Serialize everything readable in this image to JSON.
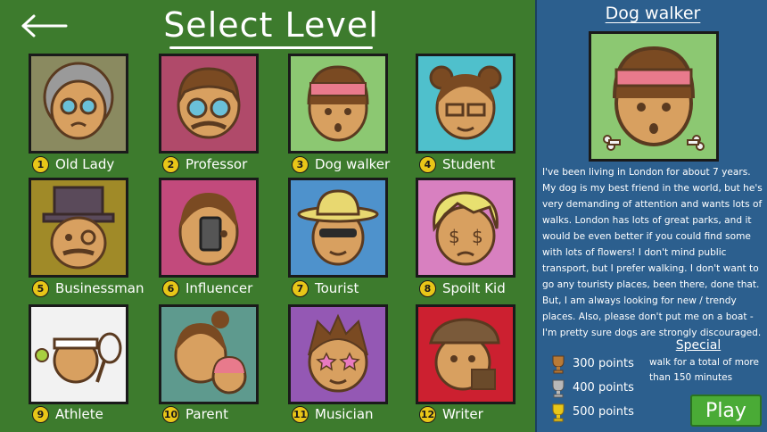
{
  "screen": {
    "title": "Select Level",
    "back_icon": "arrow-left-icon"
  },
  "levels": [
    {
      "number": "1",
      "name": "Old Lady",
      "bg": "#8a8a60"
    },
    {
      "number": "2",
      "name": "Professor",
      "bg": "#b04a6a"
    },
    {
      "number": "3",
      "name": "Dog walker",
      "bg": "#8cc872"
    },
    {
      "number": "4",
      "name": "Student",
      "bg": "#4fc0cc"
    },
    {
      "number": "5",
      "name": "Businessman",
      "bg": "#a08a28"
    },
    {
      "number": "6",
      "name": "Influencer",
      "bg": "#c24a7c"
    },
    {
      "number": "7",
      "name": "Tourist",
      "bg": "#4e92cc"
    },
    {
      "number": "8",
      "name": "Spoilt Kid",
      "bg": "#d880c0"
    },
    {
      "number": "9",
      "name": "Athlete",
      "bg": "#f2f2f2"
    },
    {
      "number": "10",
      "name": "Parent",
      "bg": "#5e9a8e"
    },
    {
      "number": "11",
      "name": "Musician",
      "bg": "#9458b4"
    },
    {
      "number": "12",
      "name": "Writer",
      "bg": "#cc2030"
    }
  ],
  "detail": {
    "title": "Dog walker",
    "description": "I've been living in London for about 7 years. My dog is my best friend in the world, but he's very demanding of attention and wants lots of walks. London has lots of great parks, and it would be even better if you could find some with lots of flowers! I don't mind public transport, but I prefer walking. I don't want to go any touristy places, been there, done that. But, I am always looking for new / trendy places. Also, please don't put me on a boat - I'm pretty sure dogs are strongly discouraged.",
    "special_title": "Special",
    "special_text": "walk for a total of more than 150 minutes",
    "trophies": [
      {
        "label": "300 points",
        "icon": "bronze-trophy-icon",
        "color": "#b87a36"
      },
      {
        "label": "400 points",
        "icon": "silver-trophy-icon",
        "color": "#b8b8b8"
      },
      {
        "label": "500 points",
        "icon": "gold-trophy-icon",
        "color": "#e8c618"
      }
    ],
    "play_label": "Play"
  },
  "colors": {
    "main_bg": "#3d7b2d",
    "panel_bg": "#2c5f8e",
    "play_button": "#4aab36",
    "badge": "#e8c618"
  }
}
